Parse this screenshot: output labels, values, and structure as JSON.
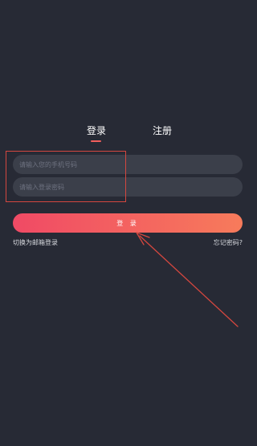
{
  "tabs": {
    "login": "登录",
    "register": "注册"
  },
  "form": {
    "phone_placeholder": "请输入您的手机号码",
    "password_placeholder": "请输入登录密码",
    "login_button": "登 录"
  },
  "links": {
    "switch_email": "切换为邮箱登录",
    "forgot_password": "忘记密码?"
  },
  "colors": {
    "background": "#272a35",
    "field_background": "#3b3f4a",
    "accent_start": "#f04a65",
    "accent_end": "#f77b5b",
    "annotation": "#d4473f"
  }
}
